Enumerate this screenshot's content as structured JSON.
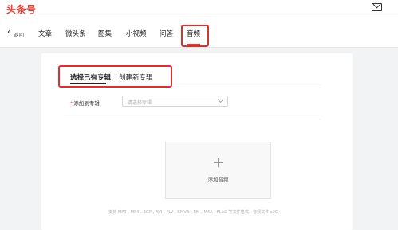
{
  "header": {
    "logo": "头条号",
    "mail_icon": "mail-icon"
  },
  "nav": {
    "back_label": "返回",
    "items": [
      {
        "label": "文章"
      },
      {
        "label": "微头条"
      },
      {
        "label": "图集"
      },
      {
        "label": "小视频"
      },
      {
        "label": "问答"
      },
      {
        "label": "音频"
      }
    ],
    "active_index": 5,
    "accent_color": "#e8392f"
  },
  "tabs": [
    {
      "label": "选择已有专辑",
      "active": true
    },
    {
      "label": "创建新专辑",
      "active": false
    }
  ],
  "form": {
    "field_label": "添加到专辑",
    "required_mark": "*",
    "select_placeholder": "请选择专辑"
  },
  "upload": {
    "button_label": "添加音频",
    "hint": "支持 MP3 , MP4 , 3GP , AVI , FLV , RMVB , RM , M4A , FLAC 等文件格式，音频文件≤2G"
  }
}
